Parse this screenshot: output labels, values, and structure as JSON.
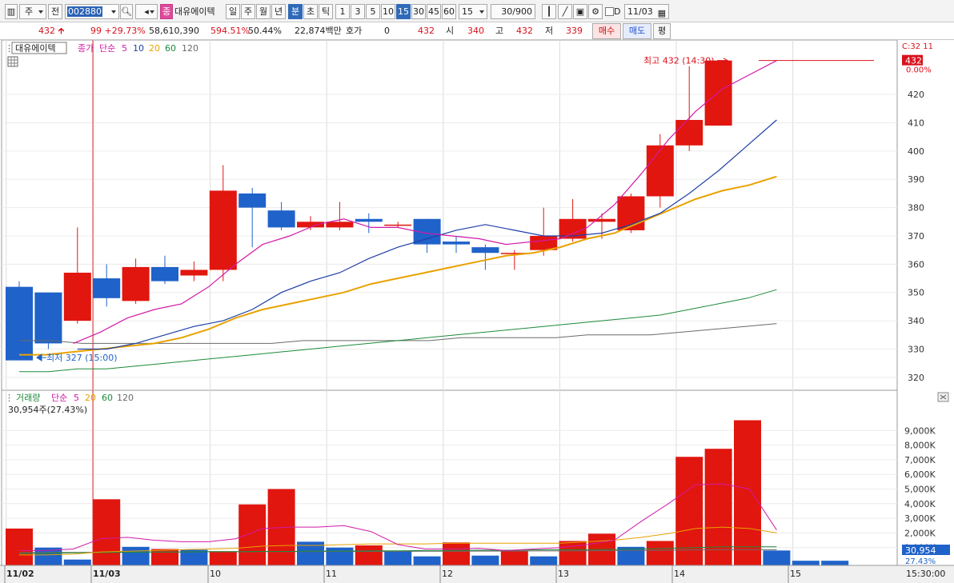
{
  "toolbar": {
    "period_short": "주",
    "all_label": "전",
    "stock_code": "002880",
    "stock_name": "대유에이텍",
    "type_badge": "종",
    "periods": [
      "일",
      "주",
      "월",
      "년"
    ],
    "minute_label": "분",
    "second_label": "초",
    "tick_label": "틱",
    "intervals": [
      "1",
      "3",
      "5",
      "10",
      "15",
      "30",
      "45",
      "60"
    ],
    "active_interval": "15",
    "interval_select": "15",
    "count": "30",
    "count_max": "/900",
    "checkbox_label": "D",
    "date": "11/03"
  },
  "quote": {
    "price": "432",
    "change": "99",
    "change_pct": "+29.73%",
    "volume": "58,610,390",
    "volume_ratio": "594.51%",
    "turnover_pct": "50.44%",
    "amount": "22,874백만",
    "hoga_label": "호가",
    "hoga_value": "0",
    "hoga_price": "432",
    "open_label": "시",
    "open": "340",
    "high_label": "고",
    "high": "432",
    "low_label": "저",
    "low": "339",
    "buy_label": "매수",
    "sell_label": "매도",
    "eval_label": "평"
  },
  "colors": {
    "up": "#e1160f",
    "down": "#1f62c9",
    "ma5": "#d21aa8",
    "ma10": "#1f3fa6",
    "ma20": "#e8a200",
    "ma60": "#1c8a3a",
    "ma120": "#6a6a6a"
  },
  "chart_data": [
    {
      "type": "candlestick",
      "legend": {
        "name": "대유에이텍",
        "price_label": "종가",
        "ma_type": "단순",
        "periods": [
          "5",
          "10",
          "20",
          "60",
          "120"
        ]
      },
      "ylim": [
        316,
        437
      ],
      "yticks": [
        320,
        330,
        340,
        350,
        360,
        370,
        380,
        390,
        400,
        410,
        420
      ],
      "price_tag": "432",
      "pct_tag": "0.00%",
      "countdown": "C:32 11",
      "max_annotation": "최고 432 (14:30)",
      "min_annotation": "최저 327 (15:00)",
      "x_labels": [
        "11/02",
        "11/03",
        "10",
        "11",
        "12",
        "13",
        "14",
        "15"
      ],
      "time_label": "15:30:00",
      "candles": [
        {
          "o": 352,
          "h": 354,
          "l": 326,
          "c": 326
        },
        {
          "o": 350,
          "h": 350,
          "l": 330,
          "c": 332
        },
        {
          "o": 340,
          "h": 373,
          "l": 339,
          "c": 357
        },
        {
          "o": 355,
          "h": 360,
          "l": 345,
          "c": 348
        },
        {
          "o": 347,
          "h": 362,
          "l": 346,
          "c": 359
        },
        {
          "o": 359,
          "h": 363,
          "l": 353,
          "c": 354
        },
        {
          "o": 356,
          "h": 361,
          "l": 354,
          "c": 358
        },
        {
          "o": 358,
          "h": 395,
          "l": 354,
          "c": 386
        },
        {
          "o": 385,
          "h": 387,
          "l": 366,
          "c": 380
        },
        {
          "o": 379,
          "h": 382,
          "l": 372,
          "c": 373
        },
        {
          "o": 373,
          "h": 377,
          "l": 372,
          "c": 375
        },
        {
          "o": 373,
          "h": 382,
          "l": 372,
          "c": 375
        },
        {
          "o": 376,
          "h": 378,
          "l": 371,
          "c": 375
        },
        {
          "o": 374,
          "h": 375,
          "l": 373,
          "c": 374
        },
        {
          "o": 376,
          "h": 376,
          "l": 364,
          "c": 367
        },
        {
          "o": 368,
          "h": 370,
          "l": 364,
          "c": 367
        },
        {
          "o": 366,
          "h": 367,
          "l": 358,
          "c": 364
        },
        {
          "o": 364,
          "h": 365,
          "l": 358,
          "c": 364
        },
        {
          "o": 365,
          "h": 380,
          "l": 363,
          "c": 370
        },
        {
          "o": 369,
          "h": 383,
          "l": 368,
          "c": 376
        },
        {
          "o": 375,
          "h": 378,
          "l": 369,
          "c": 376
        },
        {
          "o": 372,
          "h": 385,
          "l": 371,
          "c": 384
        },
        {
          "o": 384,
          "h": 406,
          "l": 380,
          "c": 402
        },
        {
          "o": 402,
          "h": 430,
          "l": 400,
          "c": 411
        },
        {
          "o": 409,
          "h": 432,
          "l": 409,
          "c": 432
        }
      ],
      "ma": {
        "ma5": [
          null,
          null,
          332,
          336,
          341,
          344,
          346,
          352,
          360,
          367,
          370,
          374,
          376,
          373,
          373,
          371,
          370,
          369,
          367,
          368,
          369,
          373,
          381,
          392,
          404,
          414,
          422,
          427,
          432
        ],
        "ma10": [
          null,
          null,
          330,
          330,
          332,
          335,
          338,
          340,
          344,
          350,
          354,
          357,
          362,
          366,
          369,
          372,
          374,
          372,
          370,
          370,
          371,
          374,
          378,
          385,
          393,
          402,
          411
        ],
        "ma20": [
          328,
          328,
          329,
          330,
          331,
          332,
          334,
          337,
          341,
          344,
          346,
          348,
          350,
          353,
          355,
          357,
          359,
          361,
          363,
          364,
          366,
          369,
          371,
          375,
          379,
          383,
          386,
          388,
          391
        ],
        "ma60": [
          322,
          322,
          323,
          323,
          324,
          325,
          326,
          327,
          328,
          329,
          330,
          331,
          332,
          333,
          334,
          335,
          336,
          337,
          338,
          339,
          340,
          341,
          342,
          344,
          346,
          348,
          351
        ],
        "ma120": [
          333,
          333,
          332,
          332,
          332,
          332,
          332,
          332,
          332,
          333,
          333,
          333,
          333,
          333,
          334,
          334,
          334,
          334,
          335,
          335,
          335,
          336,
          337,
          338,
          339
        ]
      }
    },
    {
      "type": "bar",
      "legend": {
        "name": "거래량",
        "ma_type": "단순",
        "periods": [
          "5",
          "20",
          "60",
          "120"
        ]
      },
      "value_label": "30,954주(27.43%)",
      "ylim": [
        0,
        10000
      ],
      "yticks": [
        "1,000K",
        "2,000K",
        "3,000K",
        "4,000K",
        "5,000K",
        "6,000K",
        "7,000K",
        "8,000K",
        "9,000K"
      ],
      "current_tag": "30,954",
      "current_pct": "27.43%",
      "bars": [
        {
          "v": 2300,
          "up": true
        },
        {
          "v": 1000,
          "up": false
        },
        {
          "v": 180,
          "up": false
        },
        {
          "v": 4300,
          "up": true
        },
        {
          "v": 1050,
          "up": false
        },
        {
          "v": 900,
          "up": true
        },
        {
          "v": 850,
          "up": false
        },
        {
          "v": 750,
          "up": true
        },
        {
          "v": 3950,
          "up": true
        },
        {
          "v": 5000,
          "up": true
        },
        {
          "v": 1400,
          "up": false
        },
        {
          "v": 1000,
          "up": false
        },
        {
          "v": 1150,
          "up": true
        },
        {
          "v": 750,
          "up": false
        },
        {
          "v": 400,
          "up": false
        },
        {
          "v": 1350,
          "up": true
        },
        {
          "v": 450,
          "up": false
        },
        {
          "v": 800,
          "up": true
        },
        {
          "v": 400,
          "up": false
        },
        {
          "v": 1450,
          "up": true
        },
        {
          "v": 1950,
          "up": true
        },
        {
          "v": 1050,
          "up": false
        },
        {
          "v": 1450,
          "up": true
        },
        {
          "v": 7200,
          "up": true
        },
        {
          "v": 7750,
          "up": true
        },
        {
          "v": 9700,
          "up": true
        },
        {
          "v": 800,
          "up": false
        },
        {
          "v": 100,
          "up": false
        },
        {
          "v": 100,
          "up": false
        }
      ],
      "ma": {
        "ma5": [
          800,
          800,
          900,
          1600,
          1700,
          1500,
          1400,
          1400,
          1600,
          2300,
          2400,
          2400,
          2500,
          2100,
          1200,
          900,
          900,
          950,
          800,
          900,
          1000,
          1200,
          1500,
          2800,
          4000,
          5300,
          5350,
          5000,
          2200
        ],
        "ma20": [
          500,
          500,
          550,
          700,
          750,
          800,
          850,
          900,
          950,
          1100,
          1150,
          1150,
          1200,
          1250,
          1250,
          1250,
          1300,
          1300,
          1300,
          1300,
          1300,
          1400,
          1500,
          1700,
          1950,
          2300,
          2400,
          2300,
          2000
        ],
        "ma60": [
          600,
          620,
          640,
          660,
          680,
          700,
          700,
          720,
          720,
          740,
          740,
          760,
          760,
          780,
          780,
          800,
          800,
          820,
          820,
          840,
          850,
          860,
          880,
          900,
          950,
          1000,
          1050,
          1050,
          1050
        ],
        "ma120": [
          650,
          660,
          670,
          680,
          690,
          700,
          700,
          710,
          710,
          720,
          720,
          730,
          730,
          740,
          740,
          750,
          750,
          760,
          760,
          770,
          770,
          780,
          790,
          800,
          820,
          840,
          850,
          850,
          850
        ]
      }
    }
  ]
}
